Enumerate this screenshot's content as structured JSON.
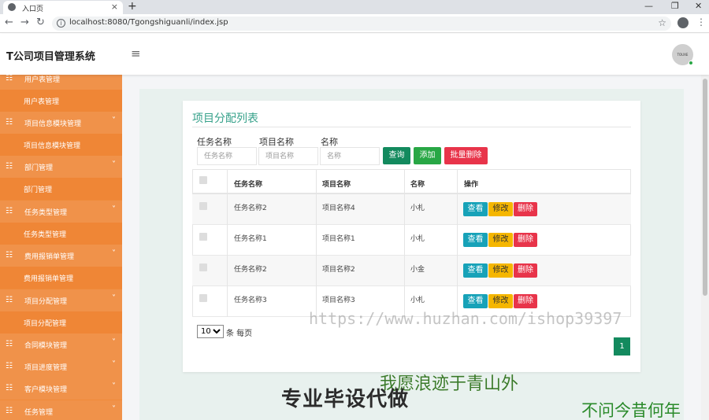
{
  "browser": {
    "tab_title": "入口页",
    "tab_close": "×",
    "new_tab": "+",
    "minimize": "—",
    "restore": "❐",
    "close": "✕",
    "back": "←",
    "forward": "→",
    "reload": "↻",
    "info_glyph": "i",
    "url": "localhost:8080/Tgongshiguanli/index.jsp",
    "star": "☆",
    "menu": "⋮"
  },
  "header": {
    "title": "T公司项目管理系统",
    "menu_glyph": "≡",
    "avatar_text": "TOUXE"
  },
  "sidebar": {
    "icon_glyph": "☷",
    "caret_glyph": "˅",
    "items": [
      {
        "type": "parent",
        "label": "用户表管理"
      },
      {
        "type": "child",
        "label": "用户表管理"
      },
      {
        "type": "parent",
        "label": "项目信息模块管理"
      },
      {
        "type": "child",
        "label": "项目信息模块管理"
      },
      {
        "type": "parent",
        "label": "部门管理"
      },
      {
        "type": "child",
        "label": "部门管理"
      },
      {
        "type": "parent",
        "label": "任务类型管理"
      },
      {
        "type": "child",
        "label": "任务类型管理"
      },
      {
        "type": "parent",
        "label": "费用报销单管理"
      },
      {
        "type": "child",
        "label": "费用报销单管理"
      },
      {
        "type": "parent",
        "label": "项目分配管理"
      },
      {
        "type": "child",
        "label": "项目分配管理"
      },
      {
        "type": "parent",
        "label": "合同模块管理"
      },
      {
        "type": "parent",
        "label": "项目进度管理"
      },
      {
        "type": "parent",
        "label": "客户模块管理"
      },
      {
        "type": "parent",
        "label": "任务管理"
      }
    ]
  },
  "card": {
    "title": "项目分配列表"
  },
  "filters": {
    "task_label": "任务名称",
    "task_placeholder": "任务名称",
    "project_label": "项目名称",
    "project_placeholder": "项目名称",
    "name_label": "名称",
    "name_placeholder": "名称",
    "search_label": "查询",
    "add_label": "添加",
    "batch_delete_label": "批量删除"
  },
  "table": {
    "headers": {
      "task": "任务名称",
      "project": "项目名称",
      "name": "名称",
      "actions": "操作"
    },
    "rows": [
      {
        "task": "任务名称2",
        "project": "项目名称4",
        "name": "小札"
      },
      {
        "task": "任务名称1",
        "project": "项目名称1",
        "name": "小札"
      },
      {
        "task": "任务名称2",
        "project": "项目名称2",
        "name": "小金"
      },
      {
        "task": "任务名称3",
        "project": "项目名称3",
        "name": "小札"
      }
    ],
    "view_label": "查看",
    "edit_label": "修改",
    "delete_label": "删除"
  },
  "pagination": {
    "page_size": "10",
    "page_size_suffix": "条 每页",
    "current_page": "1"
  },
  "watermarks": {
    "url": "https://www.huzhan.com/ishop39397",
    "line1": "我愿浪迹于青山外",
    "line2": "专业毕设代做",
    "line3": "不问今昔何年"
  },
  "colors": {
    "sidebar": "#ef8a3a",
    "title_green": "#36a18a",
    "primary": "#138a5e",
    "success": "#28a745",
    "danger": "#e8344a",
    "info": "#17a2b8",
    "warning": "#f5b600"
  }
}
